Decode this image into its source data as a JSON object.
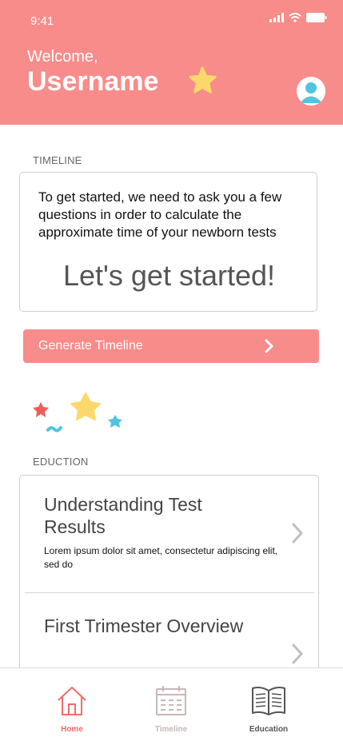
{
  "status": {
    "time": "9:41"
  },
  "header": {
    "welcome": "Welcome,",
    "username": "Username"
  },
  "timeline": {
    "section_label": "TIMELINE",
    "intro": "To get started, we need to ask you a few questions in order to calculate the approximate time of your newborn tests",
    "cta": "Let's get started!",
    "button_label": "Generate Timeline"
  },
  "education": {
    "section_label": "EDUCTION",
    "items": [
      {
        "title": "Understanding Test Results",
        "desc": "Lorem ipsum dolor sit amet, consectetur adipiscing elit, sed do"
      },
      {
        "title": "First Trimester Overview",
        "desc": ""
      }
    ]
  },
  "tabs": [
    {
      "label": "Home",
      "icon": "home-icon",
      "color": "#f26b6b"
    },
    {
      "label": "Timeline",
      "icon": "calendar-icon",
      "color": "#c9b7b7"
    },
    {
      "label": "Education",
      "icon": "book-icon",
      "color": "#555555"
    }
  ],
  "colors": {
    "accent": "#f88c8a",
    "star_yellow": "#fbd86a",
    "star_red": "#f15b5b",
    "star_blue": "#52c3e3"
  }
}
